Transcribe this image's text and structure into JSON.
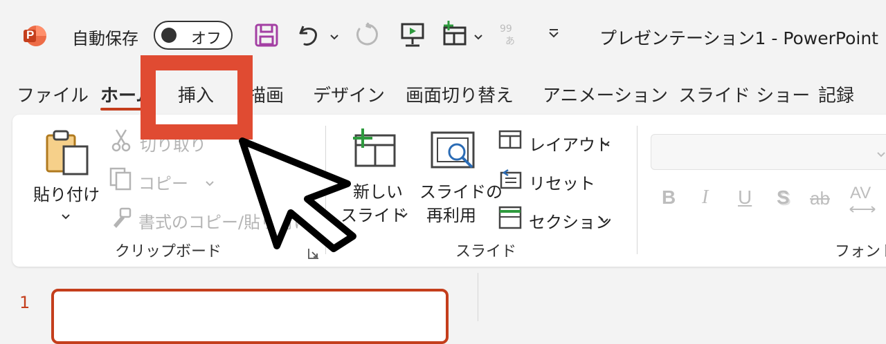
{
  "titlebar": {
    "autosave_label": "自動保存",
    "autosave_toggle_state": "オフ",
    "document_title": "プレゼンテーション1  -  PowerPoint",
    "app_icon_letter": "P"
  },
  "tabs": [
    {
      "label": "ファイル"
    },
    {
      "label": "ホーム"
    },
    {
      "label": "挿入"
    },
    {
      "label": "描画"
    },
    {
      "label": "デザイン"
    },
    {
      "label": "画面切り替え"
    },
    {
      "label": "アニメーション"
    },
    {
      "label": "スライド ショー"
    },
    {
      "label": "記録"
    }
  ],
  "ribbon": {
    "clipboard": {
      "paste_label": "貼り付け",
      "cut_label": "切り取り",
      "copy_label": "コピー",
      "format_painter_label": "書式のコピー/貼り付け",
      "group_label": "クリップボード"
    },
    "slides": {
      "new_slide_label_line1": "新しい",
      "new_slide_label_line2": "スライド",
      "reuse_label_line1": "スライドの",
      "reuse_label_line2": "再利用",
      "layout_label": "レイアウト",
      "reset_label": "リセット",
      "section_label": "セクション",
      "group_label": "スライド"
    },
    "font": {
      "bold": "B",
      "italic": "I",
      "underline": "U",
      "shadow": "S",
      "strike": "ab",
      "spacing": "AV",
      "group_label": "フォント"
    }
  },
  "slide_pane": {
    "slide_number": "1"
  },
  "colors": {
    "accent": "#c43e1c",
    "highlight_box": "#e04b32",
    "save_icon": "#a33fa3",
    "new_slide_plus": "#2e9a3e"
  }
}
